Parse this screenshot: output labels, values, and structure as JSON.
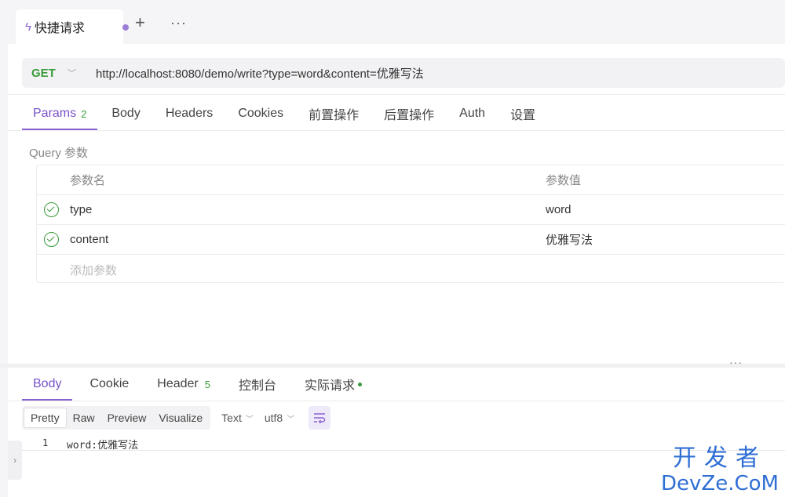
{
  "tab": {
    "title": "快捷请求",
    "plus": "+",
    "more": "···"
  },
  "request": {
    "method": "GET",
    "url": "http://localhost:8080/demo/write?type=word&content=优雅写法"
  },
  "request_tabs": [
    {
      "label": "Params",
      "badge": "2"
    },
    {
      "label": "Body"
    },
    {
      "label": "Headers"
    },
    {
      "label": "Cookies"
    },
    {
      "label": "前置操作"
    },
    {
      "label": "后置操作"
    },
    {
      "label": "Auth"
    },
    {
      "label": "设置"
    }
  ],
  "query": {
    "title": "Query 参数",
    "header": {
      "name": "参数名",
      "value": "参数值"
    },
    "rows": [
      {
        "name": "type",
        "value": "word"
      },
      {
        "name": "content",
        "value": "优雅写法"
      }
    ],
    "add_placeholder": "添加参数"
  },
  "splitter_handle": "···",
  "response_tabs": [
    {
      "label": "Body"
    },
    {
      "label": "Cookie"
    },
    {
      "label": "Header",
      "badge": "5"
    },
    {
      "label": "控制台"
    },
    {
      "label": "实际请求"
    }
  ],
  "toolbar": {
    "formats": [
      "Pretty",
      "Raw",
      "Preview",
      "Visualize"
    ],
    "type": "Text",
    "encoding": "utf8"
  },
  "code": {
    "line_number": "1",
    "text": "word:优雅写法"
  },
  "watermark": {
    "cn": "开发者",
    "en": "DevZe.CoM"
  }
}
